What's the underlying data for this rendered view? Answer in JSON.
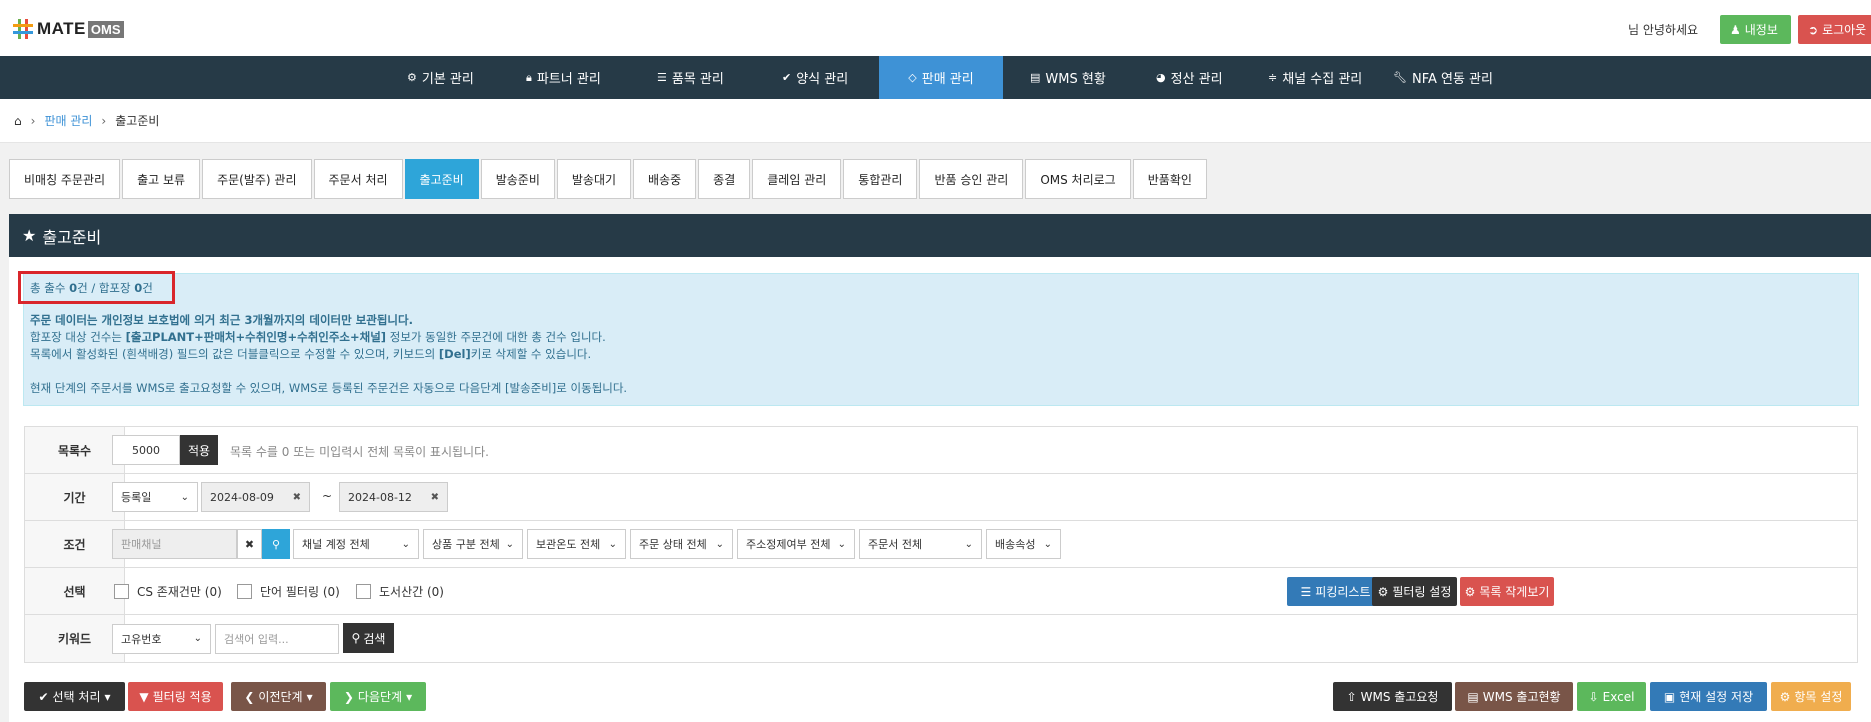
{
  "header": {
    "logo_text": "MATE",
    "logo_suffix": "OMS",
    "greeting": "님 안녕하세요",
    "my_info": "내정보",
    "logout": "로그아웃"
  },
  "nav": [
    {
      "icon": "gear-icon",
      "label": "기본 관리"
    },
    {
      "icon": "lock-icon",
      "label": "파트너 관리"
    },
    {
      "icon": "list-icon",
      "label": "품목 관리"
    },
    {
      "icon": "check-icon",
      "label": "양식 관리"
    },
    {
      "icon": "diamond-icon",
      "label": "판매 관리"
    },
    {
      "icon": "table-icon",
      "label": "WMS 현황"
    },
    {
      "icon": "pie-icon",
      "label": "정산 관리"
    },
    {
      "icon": "rss-icon",
      "label": "채널 수집 관리"
    },
    {
      "icon": "wrench-icon",
      "label": "NFA 연동 관리"
    }
  ],
  "breadcrumb": {
    "parent": "판매 관리",
    "current": "출고준비"
  },
  "tabs": [
    "비매칭 주문관리",
    "출고 보류",
    "주문(발주) 관리",
    "주문서 처리",
    "출고준비",
    "발송준비",
    "발송대기",
    "배송중",
    "종결",
    "클레임 관리",
    "통합관리",
    "반품 승인 관리",
    "OMS 처리로그",
    "반품확인"
  ],
  "panel_title": "출고준비",
  "info": {
    "count_prefix": "총 출수 ",
    "count_value": "0",
    "count_mid": "건 / 합포장 ",
    "pack_value": "0",
    "count_suffix": "건",
    "line1": "주문 데이터는 개인정보 보호법에 의거 최근 3개월까지의 데이터만 보관됩니다.",
    "line2_a": "합포장 대상 건수는 ",
    "line2_b": "[출고PLANT+판매처+수취인명+수취인주소+채널]",
    "line2_c": " 정보가 동일한 주문건에 대한 총 건수 입니다.",
    "line3_a": "목록에서 활성화된 (흰색배경) 필드의 값은 더블클릭으로 수정할 수 있으며, 키보드의 ",
    "line3_b": "[Del]",
    "line3_c": "키로 삭제할 수 있습니다.",
    "line4": "현재 단계의 주문서를 WMS로 출고요청할 수 있으며, WMS로 등록된 주문건은 자동으로 다음단계 [발송준비]로 이동됩니다."
  },
  "form": {
    "rows_label": "목록수",
    "rows_value": "5000",
    "apply": "적용",
    "rows_hint": "목록 수를 0 또는 미입력시 전체 목록이 표시됩니다.",
    "period_label": "기간",
    "period_type": "등록일",
    "date_from": "2024-08-09",
    "tilde": "~",
    "date_to": "2024-08-12",
    "cond_label": "조건",
    "channel_placeholder": "판매채널",
    "selects": [
      "채널 계정 전체",
      "상품 구분 전체",
      "보관온도 전체",
      "주문 상태 전체",
      "주소정제여부 전체",
      "주문서 전체",
      "배송속성"
    ],
    "select_label": "선택",
    "checkboxes": [
      "CS 존재건만 (0)",
      "단어 필터링 (0)",
      "도서산간 (0)"
    ],
    "picking": "피킹리스트",
    "filter_setting": "필터링 설정",
    "list_small": "목록 작게보기",
    "keyword_label": "키워드",
    "keyword_type": "고유번호",
    "keyword_placeholder": "검색어 입력...",
    "search": "검색"
  },
  "bottom": {
    "select_proc": "선택 처리",
    "filter_apply": "필터링 적용",
    "prev": "이전단계",
    "next": "다음단계",
    "wms_req": "WMS 출고요청",
    "wms_status": "WMS 출고현황",
    "excel": "Excel",
    "save": "현재 설정 저장",
    "items": "항목 설정"
  },
  "colors": {
    "nav_bg": "#263a47",
    "active_blue": "#3e92d6",
    "tab_active": "#2ea5d9",
    "info_bg": "#d9edf7",
    "highlight_red": "#d9262b"
  }
}
